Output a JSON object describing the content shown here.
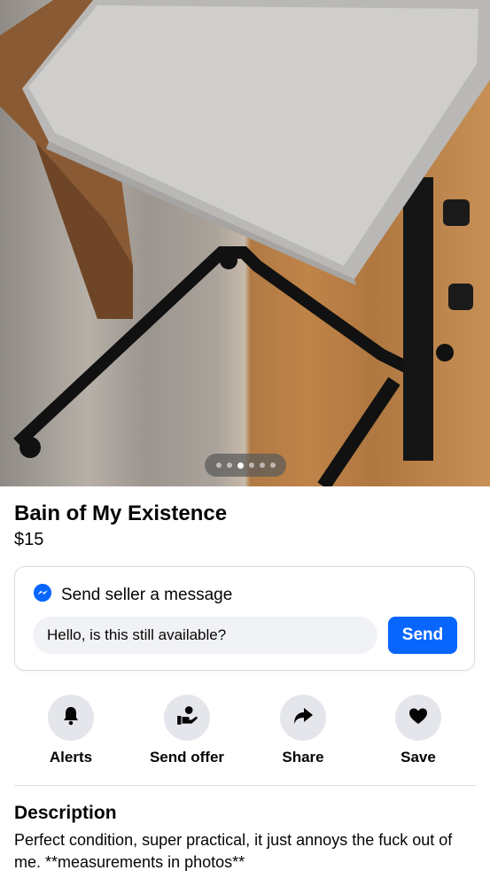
{
  "listing": {
    "photo_alt": "Overbed table on wheels",
    "photo_index": 3,
    "photo_count": 6,
    "title": "Bain of My Existence",
    "price": "$15"
  },
  "message": {
    "heading": "Send seller a message",
    "input_value": "Hello, is this still available?",
    "send_label": "Send",
    "accent_color": "#0866ff"
  },
  "actions": [
    {
      "label": "Alerts",
      "icon": "bell-icon"
    },
    {
      "label": "Send offer",
      "icon": "offer-hand-icon"
    },
    {
      "label": "Share",
      "icon": "share-arrow-icon"
    },
    {
      "label": "Save",
      "icon": "heart-icon"
    }
  ],
  "description": {
    "heading": "Description",
    "body": "Perfect condition, super practical, it just annoys the fuck out of me. **measurements in photos**"
  }
}
